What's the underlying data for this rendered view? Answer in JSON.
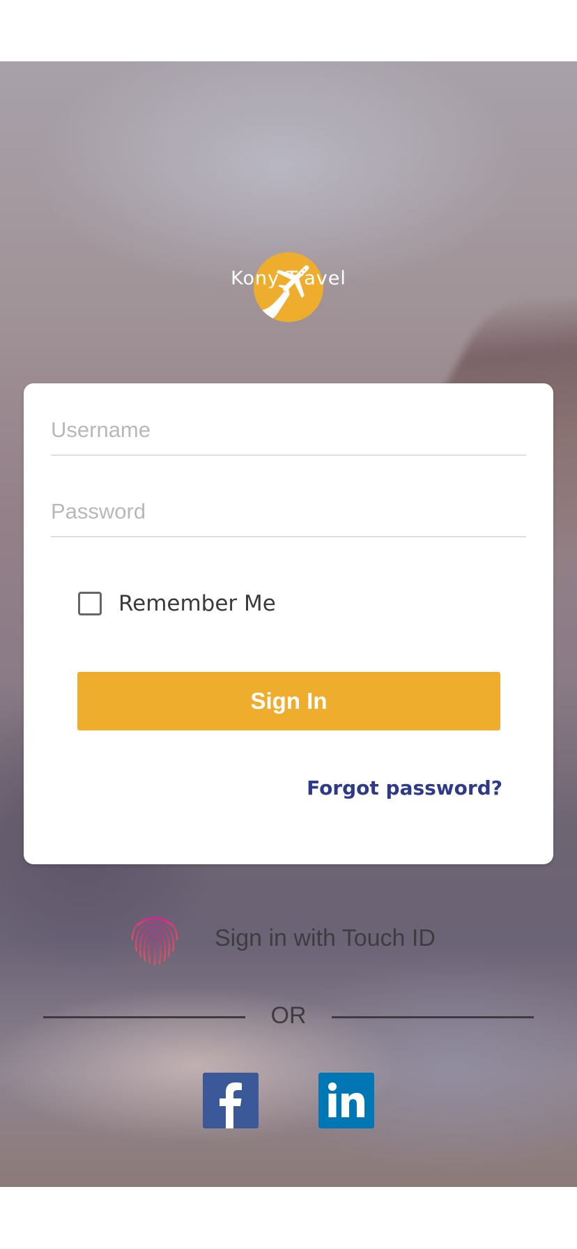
{
  "app": {
    "brand_name": "Kony Travel"
  },
  "login": {
    "username_placeholder": "Username",
    "password_placeholder": "Password",
    "remember_label": "Remember Me",
    "remember_checked": false,
    "signin_label": "Sign In",
    "forgot_label": "Forgot password?"
  },
  "alternate": {
    "touch_id_label": "Sign in with Touch ID",
    "or_label": "OR",
    "social": [
      {
        "name": "facebook",
        "icon": "facebook-icon"
      },
      {
        "name": "linkedin",
        "icon": "linkedin-icon"
      }
    ]
  },
  "colors": {
    "accent": "#efad2e",
    "link": "#2d3a8c",
    "facebook": "#3b5998",
    "linkedin": "#0077b5",
    "touch_id": "#d84a7a"
  }
}
